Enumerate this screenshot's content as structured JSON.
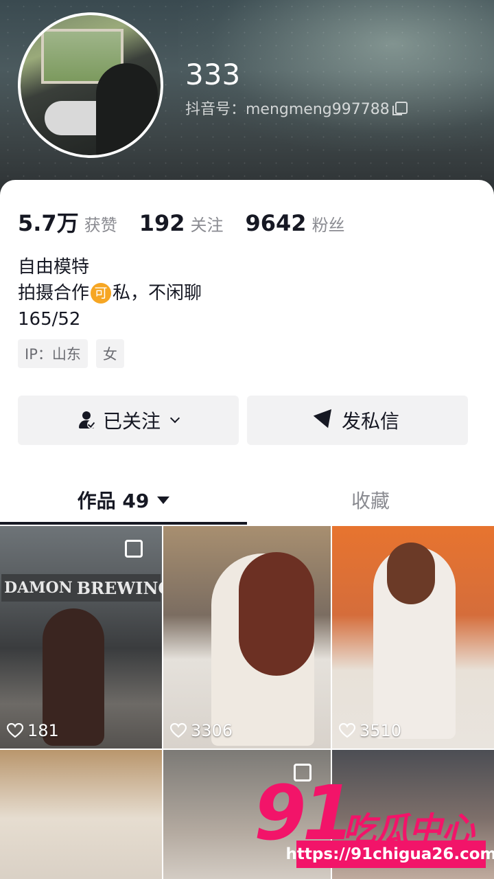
{
  "profile": {
    "username": "333",
    "account_id": "抖音号：mengmeng997788"
  },
  "stats": [
    {
      "value": "5.7万",
      "label": "获赞"
    },
    {
      "value": "192",
      "label": "关注"
    },
    {
      "value": "9642",
      "label": "粉丝"
    }
  ],
  "bio": {
    "line1": "自由模特",
    "line2_before": "拍摄合作",
    "line2_emoji": "可",
    "line2_after": "私，不闲聊",
    "line3": "165/52"
  },
  "tags": [
    "IP：山东",
    "女"
  ],
  "buttons": {
    "follow_label": "已关注",
    "message_label": "发私信"
  },
  "tabs": {
    "works_label": "作品 49",
    "favorites_label": "收藏"
  },
  "posts": [
    {
      "likes": "181",
      "sign_text_1": "DAMON",
      "sign_text_2": "BREWING"
    },
    {
      "likes": "3306"
    },
    {
      "likes": "3510"
    },
    {
      "likes": ""
    },
    {
      "likes": ""
    },
    {
      "likes": ""
    }
  ],
  "watermark": {
    "number": "91",
    "name": "吃瓜中心",
    "url": "https://91chigua26.com"
  },
  "colors": {
    "accent_watermark": "#f21469",
    "button_bg": "#f2f2f3",
    "secondary_text": "#8a8b91"
  }
}
